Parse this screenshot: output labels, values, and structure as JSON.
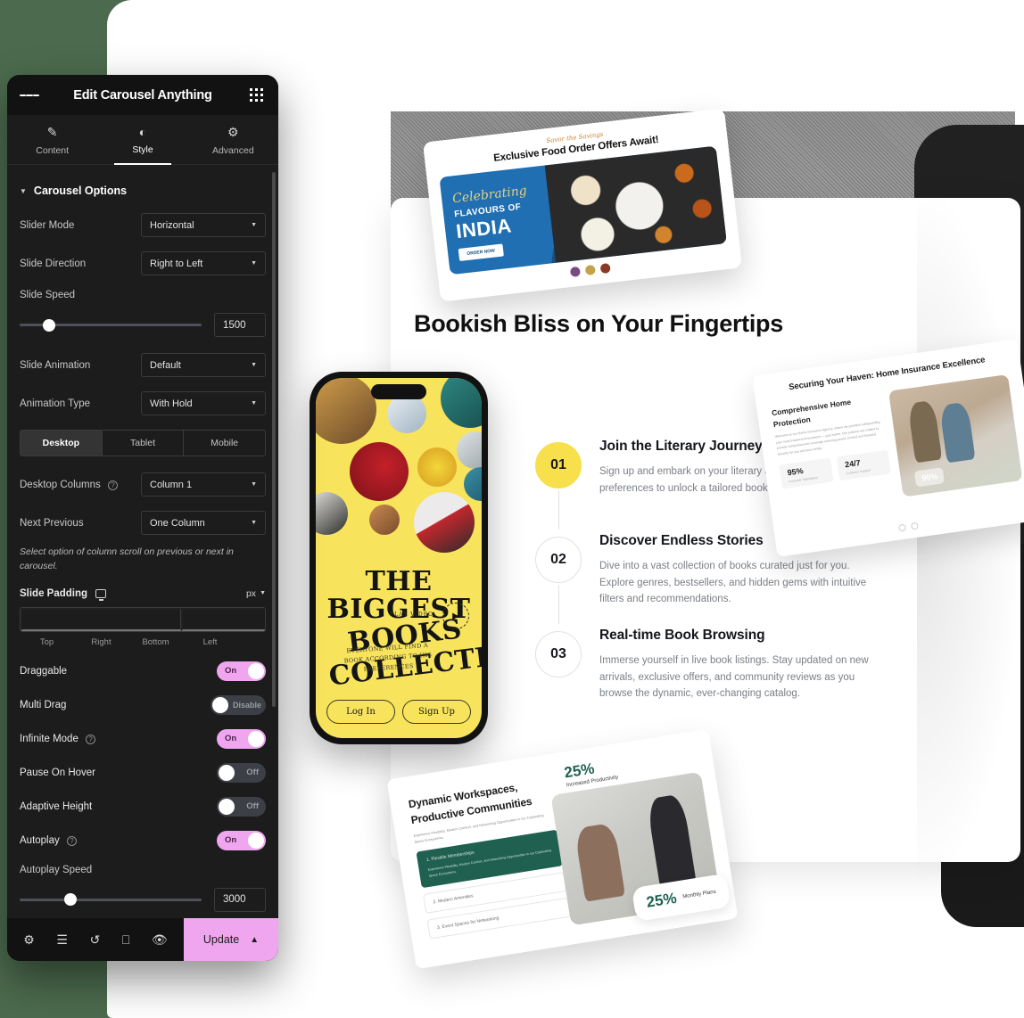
{
  "panel": {
    "header": {
      "title": "Edit Carousel Anything",
      "menu_icon": "hamburger-icon",
      "apps_icon": "grid-apps-icon"
    },
    "tabs": [
      {
        "label": "Content",
        "icon": "pencil-icon",
        "active": false
      },
      {
        "label": "Style",
        "icon": "contrast-icon",
        "active": true
      },
      {
        "label": "Advanced",
        "icon": "gear-icon",
        "active": false
      }
    ],
    "section_title": "Carousel Options",
    "fields": {
      "slider_mode": {
        "label": "Slider Mode",
        "value": "Horizontal"
      },
      "slide_direction": {
        "label": "Slide Direction",
        "value": "Right to Left"
      },
      "slide_speed": {
        "label": "Slide Speed",
        "value": "1500",
        "slider_pct": 16
      },
      "slide_animation": {
        "label": "Slide Animation",
        "value": "Default"
      },
      "animation_type": {
        "label": "Animation Type",
        "value": "With Hold"
      },
      "desktop_columns": {
        "label": "Desktop Columns",
        "value": "Column 1"
      },
      "next_previous": {
        "label": "Next Previous",
        "value": "One Column"
      },
      "help_text": "Select option of column scroll on previous or next in carousel.",
      "slide_padding": {
        "label": "Slide Padding",
        "unit": "px",
        "values": [
          "",
          "",
          "",
          ""
        ],
        "sides": [
          "Top",
          "Right",
          "Bottom",
          "Left"
        ],
        "link_icon": "link-icon",
        "device_icon": "desktop-icon"
      },
      "autoplay_speed": {
        "label": "Autoplay Speed",
        "value": "3000",
        "slider_pct": 28
      }
    },
    "device_tabs": [
      {
        "label": "Desktop",
        "active": true
      },
      {
        "label": "Tablet",
        "active": false
      },
      {
        "label": "Mobile",
        "active": false
      }
    ],
    "toggles": [
      {
        "label": "Draggable",
        "state": "On",
        "on": true,
        "info": false
      },
      {
        "label": "Multi Drag",
        "state": "Disable",
        "on": false,
        "info": false
      },
      {
        "label": "Infinite Mode",
        "state": "On",
        "on": true,
        "info": true
      },
      {
        "label": "Pause On Hover",
        "state": "Off",
        "on": false,
        "info": false
      },
      {
        "label": "Adaptive Height",
        "state": "Off",
        "on": false,
        "info": false
      },
      {
        "label": "Autoplay",
        "state": "On",
        "on": true,
        "info": true
      }
    ],
    "footer": {
      "icons": [
        "gear-icon",
        "layers-icon",
        "history-icon",
        "responsive-icon",
        "eye-icon"
      ],
      "update_label": "Update",
      "chevron": "chevron-up-icon"
    },
    "accent_color": "#f0a6ee",
    "panel_bg": "#1c1c1c"
  },
  "canvas": {
    "headline": "Bookish Bliss on Your Fingertips",
    "steps": [
      {
        "number": "01",
        "title": "Join the Literary Journey",
        "desc": "Sign up and embark on your literary adventure. P profile and preferences to unlock a tailored book-",
        "active": true
      },
      {
        "number": "02",
        "title": "Discover Endless Stories",
        "desc": "Dive into a vast collection of books curated just for you. Explore genres, bestsellers, and hidden gems with intuitive filters and recommendations.",
        "active": false
      },
      {
        "number": "03",
        "title": "Real-time Book Browsing",
        "desc": "Immerse yourself in live book listings. Stay updated on new arrivals, exclusive offers, and community reviews as you browse the dynamic, ever-changing catalog.",
        "active": false
      }
    ],
    "food_card": {
      "brand": "Savor the Savings",
      "heading": "Exclusive Food Order Offers Await!",
      "banner_script": "Celebrating",
      "banner_line2": "FLAVOURS OF",
      "banner_line3": "INDIA",
      "banner_button": "ORDER NOW"
    },
    "phone": {
      "title_line1": "THE",
      "title_line2": "BIGGEST",
      "title_line3": "BOOKS COLLECTI",
      "sub": "EVERYONE WILL FIND A BOOK ACCORDING TO HIS PREFERENCES",
      "play_label": "PLAY VIDEO",
      "play_icon": "play-icon",
      "login": "Log In",
      "signup": "Sign Up"
    },
    "insurance_card": {
      "heading": "Securing Your Haven: Home Insurance Excellence",
      "subheading": "Comprehensive Home Protection",
      "paragraph": "Welcome to our Home Insurance Agency, where we prioritize safeguarding your most treasured investment — your home. Our policies are crafted to provide comprehensive coverage ensuring peace of mind and financial security for you and your family.",
      "stats": [
        {
          "value": "95%",
          "label": "Customer Satisfaction"
        },
        {
          "value": "24/7",
          "label": "Customer Support"
        }
      ],
      "photo_badge": "90%"
    },
    "workspace_card": {
      "heading": "Dynamic Workspaces, Productive Communities",
      "paragraph": "Experience Flexibility, Modern Comfort, and Networking Opportunities in our Captivating Space Ecosystems.",
      "items": [
        {
          "label": "1. Flexible Memberships",
          "desc": "Experience Flexibility, Modern Comfort, and Networking Opportunities in our Captivating Space Ecosystems.",
          "active": true
        },
        {
          "label": "2. Modern Amenities",
          "desc": "",
          "active": false
        },
        {
          "label": "3. Event Spaces for Networking",
          "desc": "",
          "active": false
        }
      ],
      "stats": [
        {
          "value": "25%",
          "label": "Increased Productivity"
        },
        {
          "value": "25%",
          "label": "Monthly Plans"
        }
      ]
    }
  }
}
